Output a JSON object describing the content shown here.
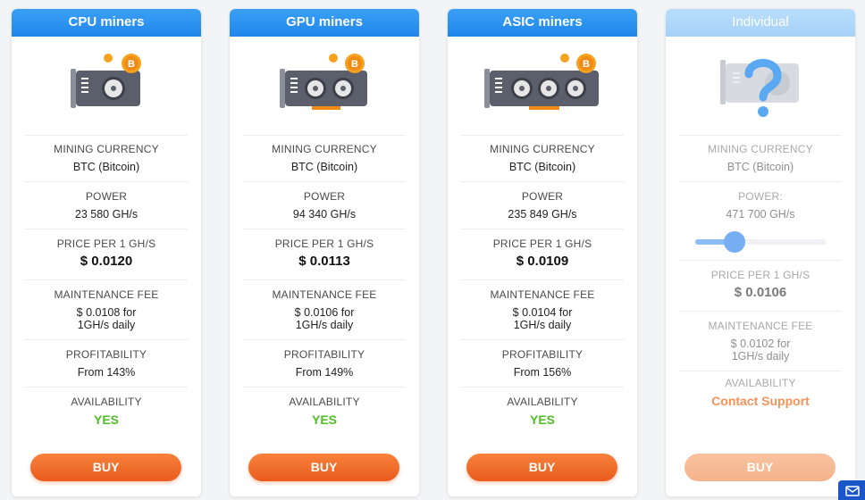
{
  "labels": {
    "currency": "MINING CURRENCY",
    "power": "POWER",
    "power_alt": "POWER:",
    "price": "PRICE PER 1 GH/S",
    "fee": "MAINTENANCE FEE",
    "profit": "PROFITABILITY",
    "availability": "AVAILABILITY"
  },
  "colors": {
    "header_blue": "#2a93f1",
    "buy_orange": "#ef6c2b",
    "yes_green": "#4fbf23",
    "contact_orange": "#f3935a"
  },
  "cards": [
    {
      "title": "CPU miners",
      "icon": "gpu-card-bitcoin",
      "currency": "BTC (Bitcoin)",
      "power": "23 580 GH/s",
      "price": "$ 0.0120",
      "fee_1": "$ 0.0108 for",
      "fee_2": "1GH/s daily",
      "profit": "From 143%",
      "availability": "YES",
      "buy": "BUY"
    },
    {
      "title": "GPU miners",
      "icon": "gpu-card-bitcoin",
      "currency": "BTC (Bitcoin)",
      "power": "94 340 GH/s",
      "price": "$ 0.0113",
      "fee_1": "$ 0.0106 for",
      "fee_2": "1GH/s daily",
      "profit": "From 149%",
      "availability": "YES",
      "buy": "BUY"
    },
    {
      "title": "ASIC miners",
      "icon": "gpu-card-bitcoin",
      "currency": "BTC (Bitcoin)",
      "power": "235 849 GH/s",
      "price": "$ 0.0109",
      "fee_1": "$ 0.0104 for",
      "fee_2": "1GH/s daily",
      "profit": "From 156%",
      "availability": "YES",
      "buy": "BUY"
    },
    {
      "title": "Individual",
      "icon": "question-mark-gpu",
      "currency": "BTC (Bitcoin)",
      "power": "471 700 GH/s",
      "slider_level": 0.3,
      "price": "$ 0.0106",
      "fee_1": "$ 0.0102 for",
      "fee_2": "1GH/s daily",
      "availability": "Contact Support",
      "buy": "BUY"
    }
  ]
}
